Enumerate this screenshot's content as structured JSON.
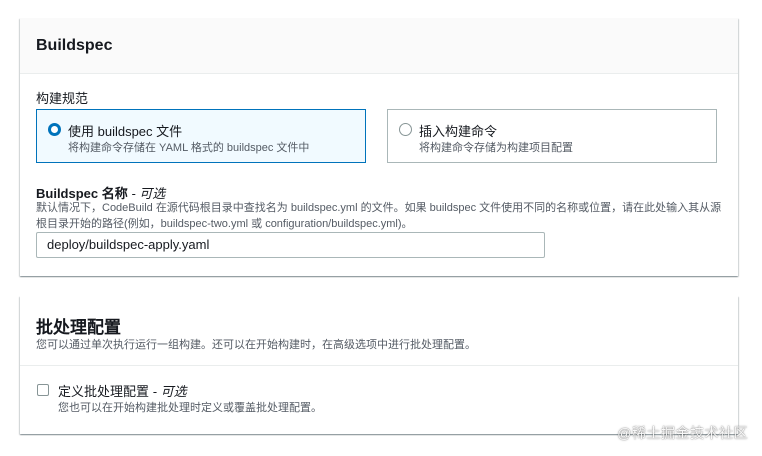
{
  "buildspec": {
    "title": "Buildspec",
    "spec_label": "构建规范",
    "options": [
      {
        "title": "使用 buildspec 文件",
        "desc": "将构建命令存储在 YAML 格式的 buildspec 文件中",
        "selected": true
      },
      {
        "title": "插入构建命令",
        "desc": "将构建命令存储为构建项目配置",
        "selected": false
      }
    ],
    "name_label": "Buildspec 名称",
    "name_optional": " - 可选",
    "name_help": "默认情况下，CodeBuild 在源代码根目录中查找名为 buildspec.yml 的文件。如果 buildspec 文件使用不同的名称或位置，请在此处输入其从源根目录开始的路径(例如，buildspec-two.yml 或 configuration/buildspec.yml)。",
    "name_value": "deploy/buildspec-apply.yaml"
  },
  "batch": {
    "title": "批处理配置",
    "desc": "您可以通过单次执行运行一组构建。还可以在开始构建时，在高级选项中进行批处理配置。",
    "checkbox_label": "定义批处理配置",
    "checkbox_optional": " - 可选",
    "checkbox_desc": "您也可以在开始构建批处理时定义或覆盖批处理配置。",
    "checked": false
  },
  "watermark": "@稀土掘金技术社区",
  "colors": {
    "accent": "#0073bb",
    "selected_bg": "#f1faff",
    "border": "#aab7b8"
  }
}
